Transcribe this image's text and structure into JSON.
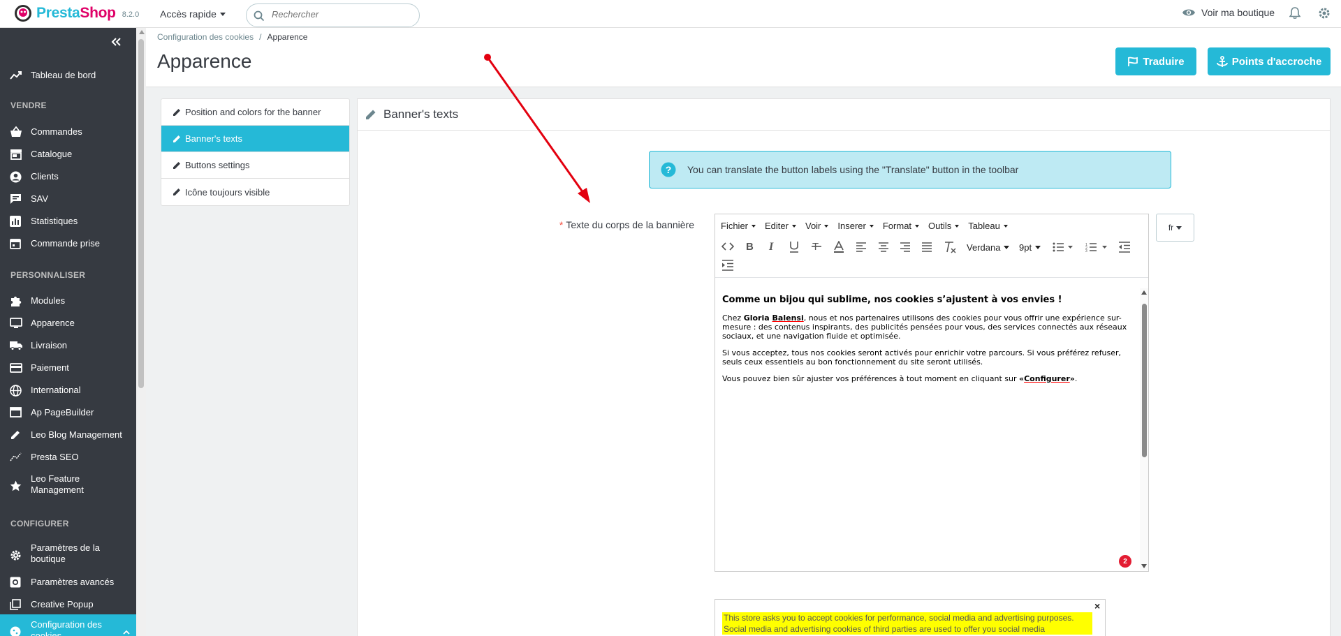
{
  "app": {
    "name_a": "Presta",
    "name_b": "Shop",
    "version": "8.2.0"
  },
  "topbar": {
    "quick_access": "Accès rapide",
    "search_placeholder": "Rechercher",
    "view_shop": "Voir ma boutique"
  },
  "sidebar": {
    "items": [
      {
        "label": "Tableau de bord"
      },
      {
        "label": "Commandes"
      },
      {
        "label": "Catalogue"
      },
      {
        "label": "Clients"
      },
      {
        "label": "SAV"
      },
      {
        "label": "Statistiques"
      },
      {
        "label": "Commande prise"
      },
      {
        "label": "Modules"
      },
      {
        "label": "Apparence"
      },
      {
        "label": "Livraison"
      },
      {
        "label": "Paiement"
      },
      {
        "label": "International"
      },
      {
        "label": "Ap PageBuilder"
      },
      {
        "label": "Leo Blog Management"
      },
      {
        "label": "Presta SEO"
      },
      {
        "label": "Leo Feature Management"
      },
      {
        "label": "Paramètres de la boutique"
      },
      {
        "label": "Paramètres avancés"
      },
      {
        "label": "Creative Popup"
      },
      {
        "label": "Configuration des cookies"
      }
    ],
    "sections": {
      "sell": "VENDRE",
      "customize": "PERSONNALISER",
      "configure": "CONFIGURER"
    }
  },
  "breadcrumb": {
    "parent": "Configuration des cookies",
    "separator": "/",
    "current": "Apparence"
  },
  "page": {
    "title": "Apparence",
    "translate_button": "Traduire",
    "hooks_button": "Points d'accroche"
  },
  "tabs": [
    {
      "label": "Position and colors for the banner"
    },
    {
      "label": "Banner's texts"
    },
    {
      "label": "Buttons settings"
    },
    {
      "label": "Icône toujours visible"
    }
  ],
  "panel": {
    "title": "Banner's texts",
    "info": "You can translate the button labels using the \"Translate\" button in the toolbar",
    "required_mark": "*",
    "field_label": "Texte du corps de la bannière",
    "language": "fr"
  },
  "editor": {
    "menus": [
      "Fichier",
      "Editer",
      "Voir",
      "Inserer",
      "Format",
      "Outils",
      "Tableau"
    ],
    "font_family": "Verdana",
    "font_size": "9pt",
    "heading": "Comme un bijou qui sublime, nos cookies s’ajustent à vos envies !",
    "p1_a": "Chez ",
    "p1_brand_a": "Gloria",
    "p1_brand_b": "Balensi",
    "p1_b": ", nous et nos partenaires utilisons des cookies pour vous offrir une expérience sur-mesure : des contenus inspirants, des publicités pensées pour vous, des services connectés aux réseaux sociaux, et une navigation fluide et optimisée.",
    "p2": "Si vous acceptez, tous nos cookies seront activés pour enrichir votre parcours. Si vous préférez refuser, seuls ceux essentiels au bon fonctionnement du site seront utilisés.",
    "p3_a": "Vous pouvez bien sûr ajuster vos préférences à tout moment en cliquant sur ",
    "p3_link_open": "«",
    "p3_link": "Configurer",
    "p3_link_close": "»",
    "p3_b": ".",
    "badge_count": "2"
  },
  "preview": {
    "close": "×",
    "text": "This store asks you to accept cookies for performance, social media and advertising purposes. Social media and advertising cookies of third parties are used to offer you social media"
  },
  "colors": {
    "accent": "#25b9d7",
    "sidebar": "#363a41",
    "brand_pink": "#df0067",
    "arrow": "#e3000f",
    "highlight": "#ffff00"
  }
}
